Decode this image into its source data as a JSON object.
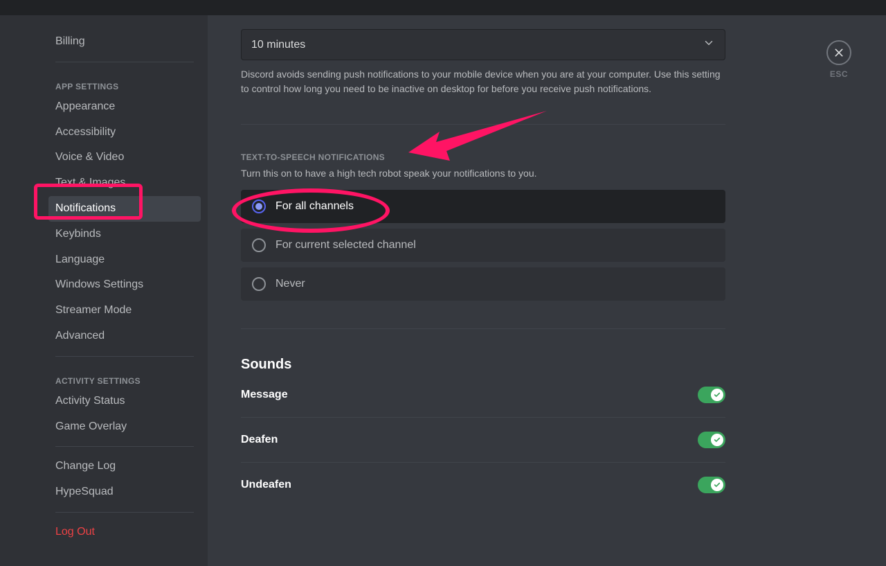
{
  "sidebar": {
    "items_top": [
      {
        "label": "Billing"
      }
    ],
    "header_app": "App Settings",
    "items_app": [
      {
        "label": "Appearance"
      },
      {
        "label": "Accessibility"
      },
      {
        "label": "Voice & Video"
      },
      {
        "label": "Text & Images"
      },
      {
        "label": "Notifications",
        "selected": true
      },
      {
        "label": "Keybinds"
      },
      {
        "label": "Language"
      },
      {
        "label": "Windows Settings"
      },
      {
        "label": "Streamer Mode"
      },
      {
        "label": "Advanced"
      }
    ],
    "header_activity": "Activity Settings",
    "items_activity": [
      {
        "label": "Activity Status"
      },
      {
        "label": "Game Overlay"
      }
    ],
    "items_misc": [
      {
        "label": "Change Log"
      },
      {
        "label": "HypeSquad"
      }
    ],
    "logout": "Log Out"
  },
  "close": {
    "label": "ESC"
  },
  "inactive": {
    "selected": "10 minutes",
    "helper": "Discord avoids sending push notifications to your mobile device when you are at your computer. Use this setting to control how long you need to be inactive on desktop for before you receive push notifications."
  },
  "tts": {
    "header": "Text-to-Speech Notifications",
    "sub": "Turn this on to have a high tech robot speak your notifications to you.",
    "options": [
      {
        "label": "For all channels",
        "selected": true
      },
      {
        "label": "For current selected channel"
      },
      {
        "label": "Never"
      }
    ]
  },
  "sounds": {
    "title": "Sounds",
    "items": [
      {
        "label": "Message",
        "on": true
      },
      {
        "label": "Deafen",
        "on": true
      },
      {
        "label": "Undeafen",
        "on": true
      }
    ]
  }
}
